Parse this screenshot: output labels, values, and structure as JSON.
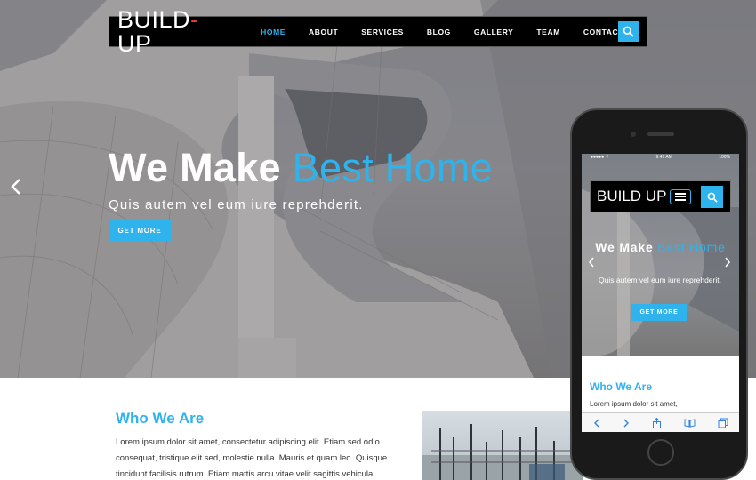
{
  "nav": {
    "logo_part1": "BUILD",
    "logo_dash": "-",
    "logo_part2": "UP",
    "items": [
      "HOME",
      "ABOUT",
      "SERVICES",
      "BLOG",
      "GALLERY",
      "TEAM",
      "CONTACT"
    ],
    "active": "HOME"
  },
  "hero": {
    "title_main": "We Make ",
    "title_accent": "Best Home",
    "subtitle": "Quis autem vel eum iure reprehderit.",
    "cta": "GET MORE"
  },
  "about": {
    "heading": "Who We Are",
    "paragraph": "Lorem ipsum dolor sit amet, consectetur adipiscing elit. Etiam sed odio consequat, tristique elit sed, molestie nulla. Mauris et quam leo. Quisque tincidunt facilisis rutrum. Etiam mattis arcu vitae velit sagittis vehicula."
  },
  "phone": {
    "status_time": "9:41 AM",
    "status_battery": "100%",
    "logo": "BUILD UP",
    "title_main": "We Make ",
    "title_accent": "Best Home",
    "subtitle": "Quis autem vel eum iure reprehderit.",
    "cta": "GET MORE",
    "heading": "Who We Are",
    "paragraph": "Lorem ipsum dolor sit amet,"
  },
  "colors": {
    "accent": "#2fb3ec",
    "nav_bg": "#000000",
    "logo_dash": "#e53935"
  },
  "icons": [
    "search-icon",
    "chevron-left-icon",
    "chevron-right-icon",
    "menu-icon",
    "share-icon",
    "bookmarks-icon",
    "tabs-icon"
  ]
}
